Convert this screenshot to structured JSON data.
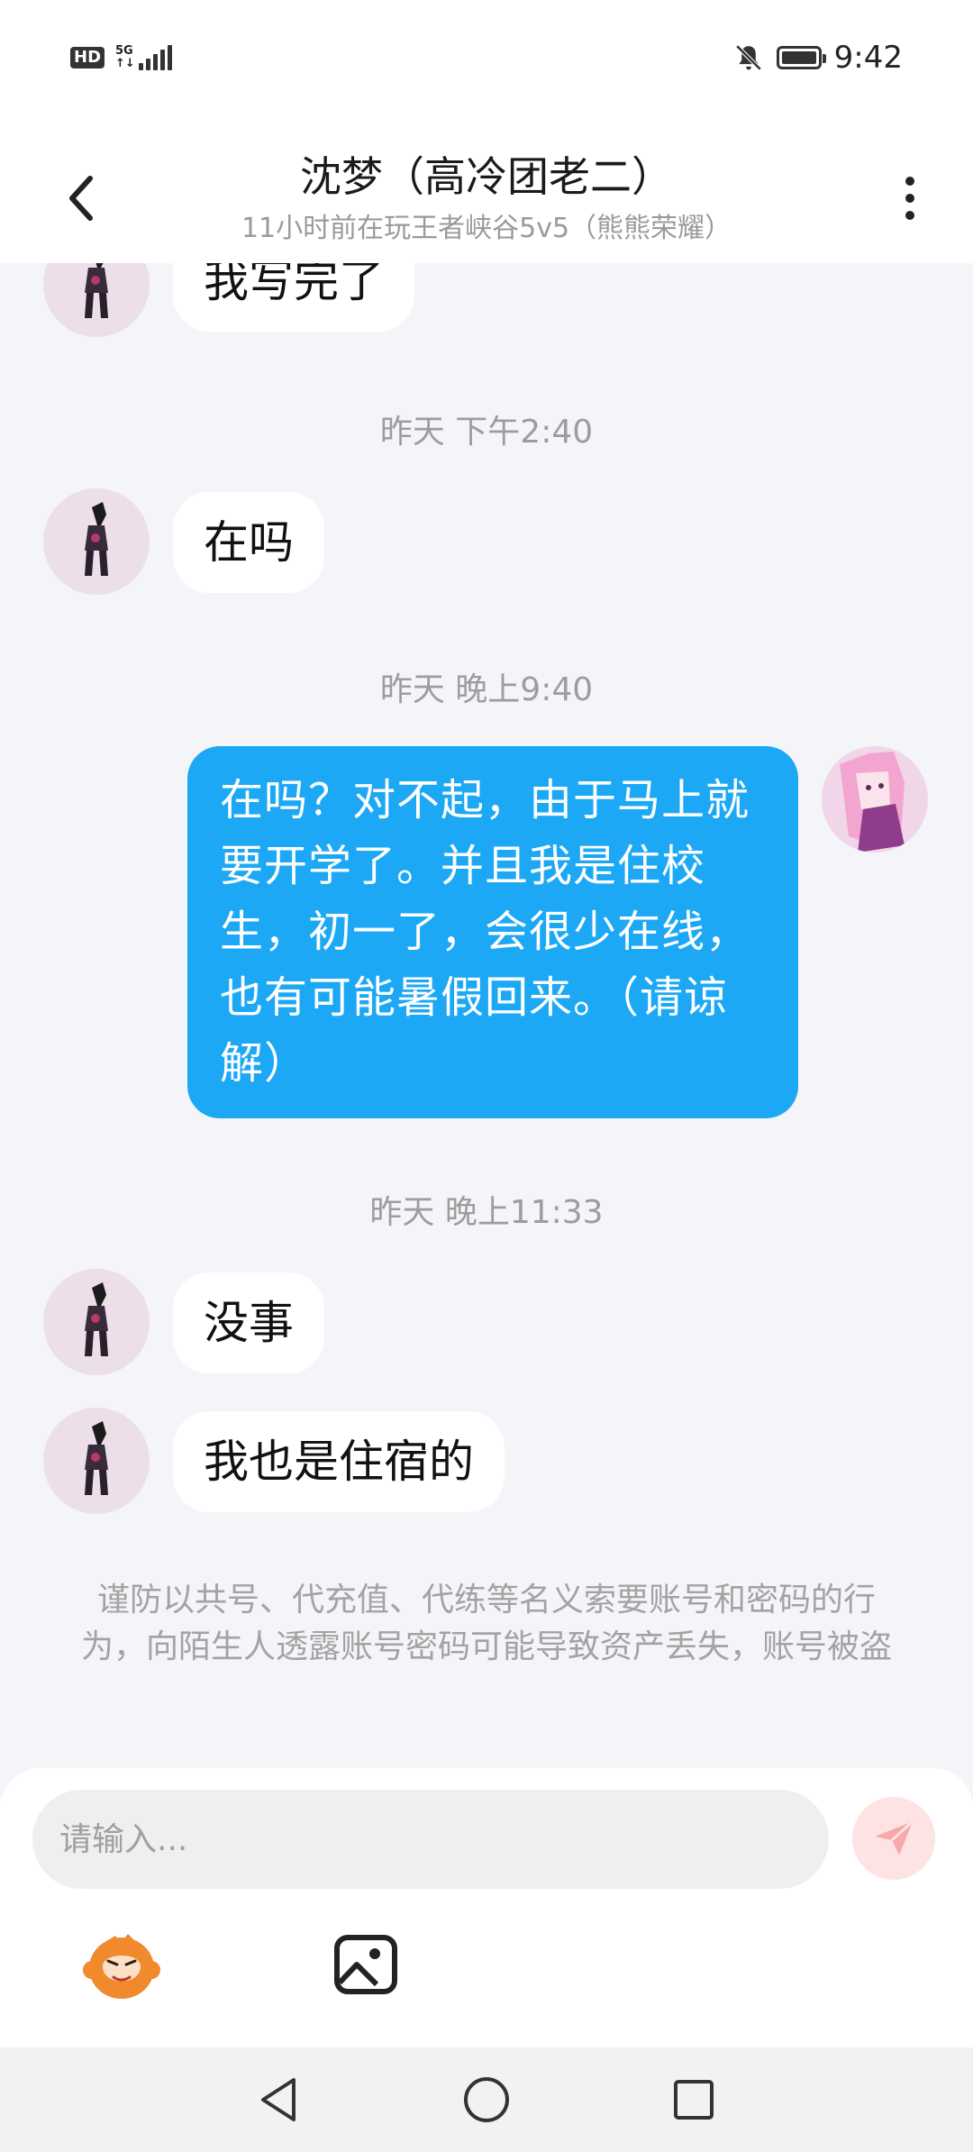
{
  "status_bar": {
    "hd_label": "HD",
    "network_top": "5G",
    "network_bottom": "↑↓",
    "time": "9:42",
    "icons": [
      "mute-bell-icon",
      "battery-icon",
      "signal-bars-icon"
    ]
  },
  "header": {
    "title": "沈梦（高冷团老二）",
    "subtitle": "11小时前在玩王者峡谷5v5（熊熊荣耀）",
    "back_icon": "chevron-left-icon",
    "more_icon": "more-vertical-icon"
  },
  "messages": [
    {
      "type": "received",
      "text": "我写完了"
    },
    {
      "type": "timestamp",
      "text": "昨天 下午2:40"
    },
    {
      "type": "received",
      "text": "在吗"
    },
    {
      "type": "timestamp",
      "text": "昨天 晚上9:40"
    },
    {
      "type": "sent",
      "text": "在吗？对不起，由于马上就要开学了。并且我是住校生，初一了，会很少在线，也有可能暑假回来。（请谅解）"
    },
    {
      "type": "timestamp",
      "text": "昨天 晚上11:33"
    },
    {
      "type": "received",
      "text": "没事"
    },
    {
      "type": "received",
      "text": "我也是住宿的"
    }
  ],
  "notice": "谨防以共号、代充值、代练等名义索要账号和密码的行为，向陌生人透露账号密码可能导致资产丢失，账号被盗",
  "input": {
    "placeholder": "请输入...",
    "send_icon": "paper-plane-icon",
    "emoji_icon": "monkey-emoji-icon",
    "image_icon": "image-icon"
  },
  "colors": {
    "sent_bubble": "#1ca8f5",
    "background": "#f3f5f9",
    "send_button_bg": "#fde3e3",
    "send_button_icon": "#f7a9a9"
  },
  "nav": [
    "back-triangle-icon",
    "home-circle-icon",
    "recents-square-icon"
  ]
}
